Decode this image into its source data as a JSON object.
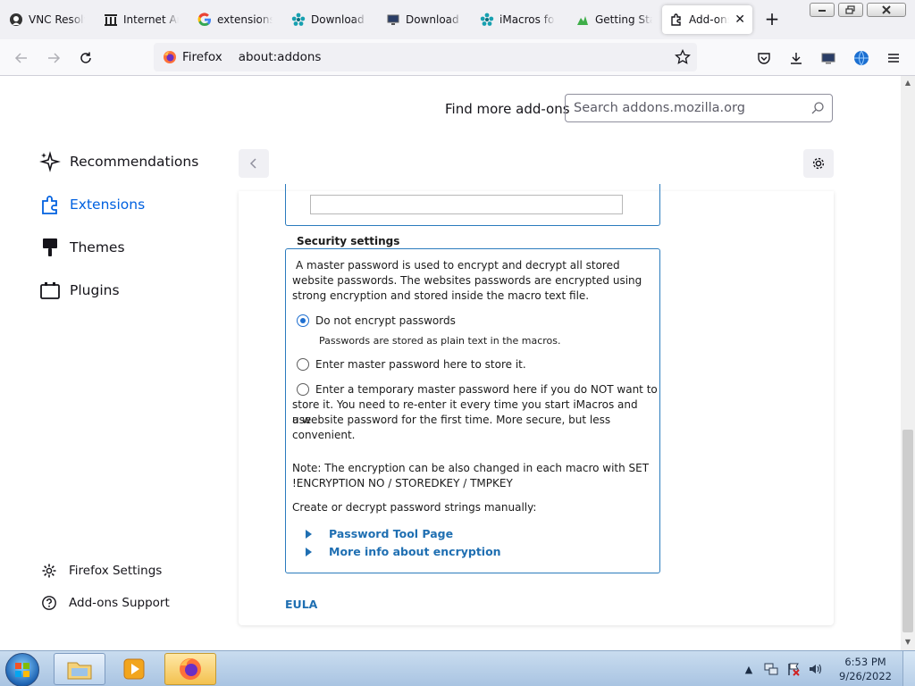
{
  "browser": {
    "tabs": [
      {
        "label": "VNC Resolv",
        "icon": "vnc-icon"
      },
      {
        "label": "Internet Arc",
        "icon": "archive-icon"
      },
      {
        "label": "extensions t",
        "icon": "google-icon"
      },
      {
        "label": "Download A",
        "icon": "imacros-icon"
      },
      {
        "label": "Download a",
        "icon": "monitor-icon"
      },
      {
        "label": "iMacros for",
        "icon": "imacros-icon"
      },
      {
        "label": "Getting Star",
        "icon": "getting-started-icon"
      },
      {
        "label": "Add-ons",
        "icon": "puzzle-icon",
        "active": true
      }
    ],
    "url_identity": "Firefox",
    "url": "about:addons"
  },
  "addons_page": {
    "find_more_label": "Find more add-ons",
    "search_placeholder": "Search addons.mozilla.org",
    "categories": [
      {
        "label": "Recommendations",
        "icon": "sparkle-icon"
      },
      {
        "label": "Extensions",
        "icon": "puzzle-icon",
        "selected": true
      },
      {
        "label": "Themes",
        "icon": "brush-icon"
      },
      {
        "label": "Plugins",
        "icon": "plugin-icon"
      }
    ],
    "footer_links": [
      {
        "label": "Firefox Settings",
        "icon": "gear-icon"
      },
      {
        "label": "Add-ons Support",
        "icon": "help-icon"
      }
    ]
  },
  "security": {
    "legend": "Security settings",
    "intro_lines": [
      "A master password is used to encrypt and decrypt all stored",
      "website passwords. The websites passwords are encrypted using",
      "strong encryption and stored inside the macro text file."
    ],
    "options": [
      {
        "label": "Do not encrypt passwords",
        "checked": true,
        "note": "Passwords are stored as plain text in the macros."
      },
      {
        "label": "Enter master password here to store it.",
        "checked": false
      },
      {
        "label_lines": [
          "Enter a temporary master password here if you do NOT want to",
          "store it. You need to re-enter it every time you start iMacros and use",
          "a website password for the first time. More secure, but less",
          "convenient."
        ],
        "checked": false
      }
    ],
    "note_lines": [
      "Note: The encryption can be also changed in each macro with SET",
      "!ENCRYPTION NO / STOREDKEY / TMPKEY"
    ],
    "manual_label": "Create or decrypt password strings manually:",
    "links": [
      "Password Tool Page",
      "More info about encryption"
    ],
    "eula": "EULA"
  },
  "taskbar": {
    "time": "6:53 PM",
    "date": "9/26/2022"
  }
}
